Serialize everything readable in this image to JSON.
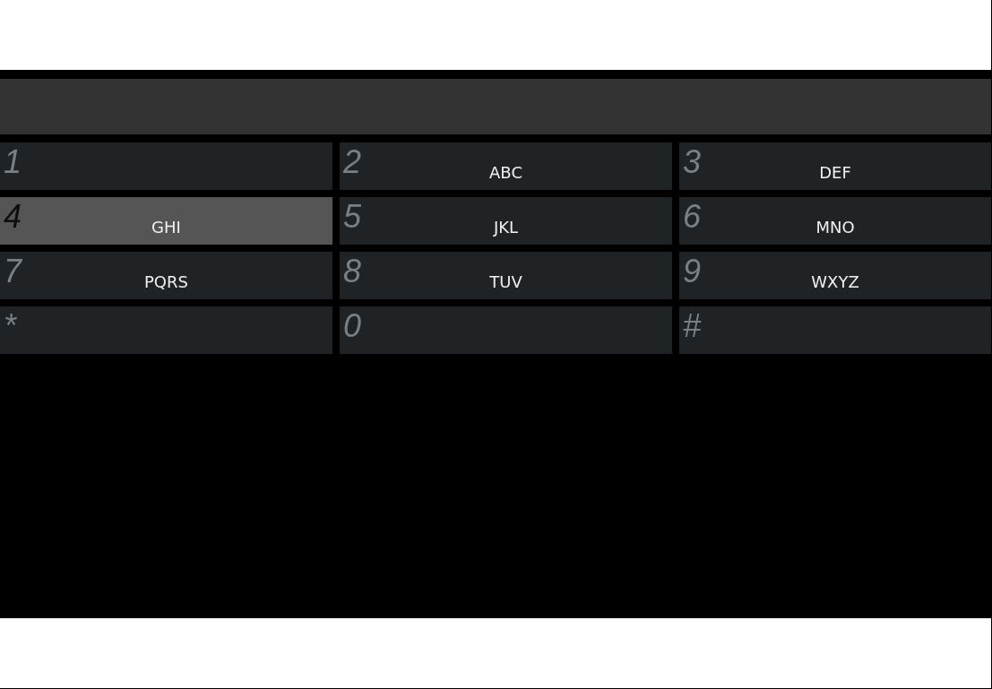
{
  "keypad": {
    "keys": [
      {
        "digit": "1",
        "selected": false
      },
      {
        "digit": "2",
        "letters": "ABC",
        "selected": false
      },
      {
        "digit": "3",
        "letters": "DEF",
        "selected": false
      },
      {
        "digit": "4",
        "letters": "GHI",
        "selected": true
      },
      {
        "digit": "5",
        "letters": "JKL",
        "selected": false
      },
      {
        "digit": "6",
        "letters": "MNO",
        "selected": false
      },
      {
        "digit": "7",
        "letters": "PQRS",
        "selected": false
      },
      {
        "digit": "8",
        "letters": "TUV",
        "selected": false
      },
      {
        "digit": "9",
        "letters": "WXYZ",
        "selected": false
      },
      {
        "digit": "*",
        "selected": false
      },
      {
        "digit": "0",
        "selected": false
      },
      {
        "digit": "#",
        "selected": false
      }
    ]
  }
}
